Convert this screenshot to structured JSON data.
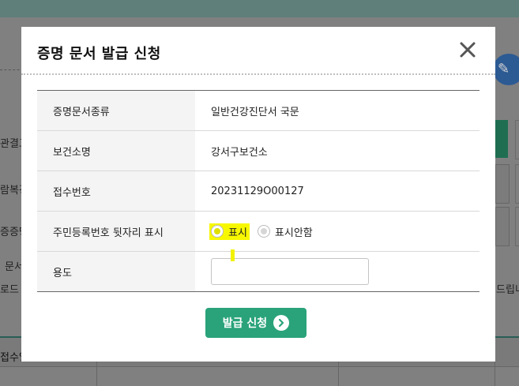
{
  "background": {
    "side_labels": [
      "관결고",
      "람복경",
      "증증명",
      "문서",
      "로드"
    ],
    "right_text": "드립니",
    "table_headers": [
      "접수일시"
    ]
  },
  "modal": {
    "title": "증명 문서 발급 신청",
    "close_icon": "close-icon",
    "rows": [
      {
        "label": "증명문서종류",
        "value": "일반건강진단서 국문"
      },
      {
        "label": "보건소명",
        "value": "강서구보건소"
      },
      {
        "label": "접수번호",
        "value": "20231129O00127"
      },
      {
        "label": "주민등록번호 뒷자리 표시"
      },
      {
        "label": "용도"
      }
    ],
    "ssn_display": {
      "options": [
        "표시",
        "표시안함"
      ],
      "selected": "표시"
    },
    "purpose_input": {
      "value": "",
      "placeholder": ""
    },
    "submit": {
      "label": "발급 신청",
      "icon": "chevron-right-circle-icon"
    }
  },
  "colors": {
    "accent": "#2aa37a",
    "highlight": "#f7f700",
    "overlay": "#808080"
  }
}
